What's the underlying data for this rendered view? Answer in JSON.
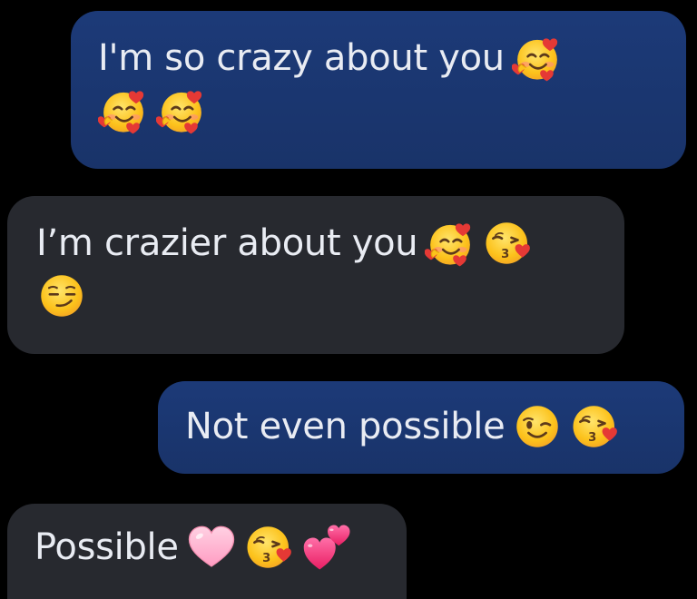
{
  "messages": [
    {
      "text": "I'm so crazy about you",
      "type": "sent"
    },
    {
      "text": "I’m crazier about you",
      "type": "received"
    },
    {
      "text": "Not even possible",
      "type": "sent"
    },
    {
      "text": "Possible",
      "type": "received"
    }
  ],
  "colors": {
    "background": "#000000",
    "sent_bubble": "#1b3672",
    "received_bubble": "#27292f",
    "text": "#e9ecf3"
  }
}
